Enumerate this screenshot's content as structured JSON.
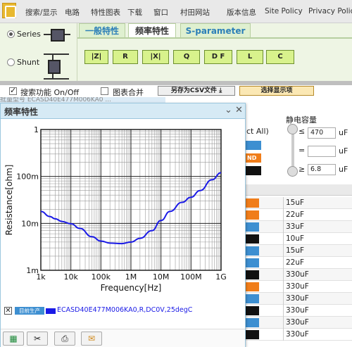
{
  "menu": {
    "items": [
      "搜索/显示",
      "电路",
      "特性图表",
      "下载",
      "窗口",
      "村田网站",
      "版本信息",
      "Site Policy",
      "Privacy Policy"
    ]
  },
  "topology": {
    "series_label": "Series",
    "shunt_label": "Shunt",
    "selected": "Series"
  },
  "tabs": [
    "一般特性",
    "频率特性",
    "S-parameter"
  ],
  "active_tab": "频率特性",
  "param_buttons": [
    "|Z|",
    "R",
    "|X|",
    "Q",
    "D F",
    "L",
    "C"
  ],
  "search_row": {
    "search_label": "搜索功能 On/Off",
    "search_checked": true,
    "overlay_label": "图表合并",
    "overlay_checked": false,
    "csv_button": "另存为CSV文件",
    "display_button": "选择显示项"
  },
  "right_panel": {
    "capacitance_label": "静电容量",
    "ops": [
      "≤",
      "=",
      "≥"
    ],
    "values": [
      "470",
      "",
      "6.8"
    ],
    "unit": "uF",
    "select_all_partial": "ct All)",
    "tag_partial": "ND",
    "table_values": [
      "15uF",
      "22uF",
      "33uF",
      "10uF",
      "15uF",
      "22uF",
      "330uF",
      "330uF",
      "330uF",
      "330uF",
      "330uF",
      "330uF"
    ],
    "tag_colors": [
      "#f07d1a",
      "#f07d1a",
      "#3d8fd1",
      "#111111",
      "#3d8fd1",
      "#3d8fd1",
      "#111111",
      "#f07d1a",
      "#3d8fd1",
      "#111111",
      "#3d8fd1",
      "#111111"
    ]
  },
  "popup": {
    "title": "频率特性",
    "controls": [
      "⌄",
      "✕"
    ],
    "under_text": "批量型号 ECASD40E477M006KA0 ..."
  },
  "chart_data": {
    "type": "line",
    "xlabel": "Frequency[Hz]",
    "ylabel": "Resistance[ohm]",
    "x_scale": "log",
    "y_scale": "log",
    "xlim": [
      1000,
      1000000000
    ],
    "ylim": [
      0.001,
      1
    ],
    "x_ticks": [
      1000,
      10000,
      100000,
      1000000,
      10000000,
      100000000,
      1000000000
    ],
    "x_tick_labels": [
      "1k",
      "10k",
      "100k",
      "1M",
      "10M",
      "100M",
      "1G"
    ],
    "y_ticks": [
      0.001,
      0.01,
      0.1,
      1
    ],
    "y_tick_labels": [
      "1m",
      "10m",
      "100m",
      "1"
    ],
    "grid": true,
    "series": [
      {
        "name": "ECASD40E477M006KA0,R,DC0V,25degC",
        "color": "#1a1ae6",
        "x": [
          1000,
          2000,
          3000,
          5000,
          10000,
          20000,
          50000,
          100000,
          200000,
          500000,
          1000000,
          2000000,
          5000000,
          10000000,
          20000000,
          50000000,
          100000000,
          200000000,
          500000000,
          1000000000
        ],
        "y": [
          0.018,
          0.014,
          0.0125,
          0.011,
          0.0098,
          0.0078,
          0.0052,
          0.0042,
          0.0038,
          0.0037,
          0.004,
          0.0048,
          0.007,
          0.0115,
          0.018,
          0.028,
          0.036,
          0.05,
          0.085,
          0.12
        ]
      }
    ],
    "legend_badge": "目前生产"
  },
  "toolbar": {
    "icons": [
      "excel-icon",
      "settings-icon",
      "print-icon",
      "memo-icon"
    ]
  }
}
